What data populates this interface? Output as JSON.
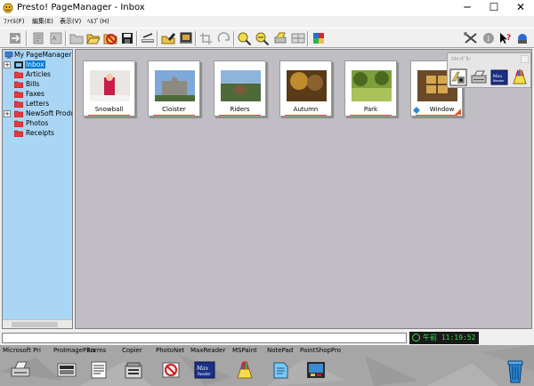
{
  "window": {
    "title": "Presto! PageManager - Inbox",
    "minimize_glyph": "─",
    "maximize_glyph": "☐",
    "close_glyph": "✕"
  },
  "menu": {
    "items": [
      {
        "label": "ﾌｧｲﾙ(F)"
      },
      {
        "label": "編集(E)"
      },
      {
        "label": "表示(V)"
      },
      {
        "label": "ﾍﾙﾌﾟ(H)"
      }
    ]
  },
  "toolbar": {
    "buttons": [
      {
        "icon": "send-icon"
      },
      {
        "icon": "page-icon"
      },
      {
        "icon": "ocr-icon"
      },
      {
        "icon": "folder-icon"
      },
      {
        "icon": "open-folder-icon"
      },
      {
        "icon": "no-entry-icon"
      },
      {
        "icon": "save-icon"
      },
      {
        "icon": "scan-icon"
      },
      {
        "icon": "edit-icon"
      },
      {
        "icon": "picture-icon"
      },
      {
        "icon": "crop-icon"
      },
      {
        "icon": "rotate-icon"
      },
      {
        "icon": "zoom-in-icon"
      },
      {
        "icon": "zoom-out-icon"
      },
      {
        "icon": "print-icon"
      },
      {
        "icon": "grid-icon"
      },
      {
        "icon": "stack-icon"
      },
      {
        "icon": "tools-icon"
      },
      {
        "icon": "info-icon"
      },
      {
        "icon": "help-icon"
      },
      {
        "icon": "scanner-icon"
      }
    ]
  },
  "tree": {
    "root": "My PageManager",
    "items": [
      {
        "label": "Inbox",
        "selected": true,
        "expander": "+"
      },
      {
        "label": "Articles"
      },
      {
        "label": "Bills"
      },
      {
        "label": "Faxes"
      },
      {
        "label": "Letters"
      },
      {
        "label": "NewSoft Products",
        "expander": "+"
      },
      {
        "label": "Photos"
      },
      {
        "label": "Receipts"
      }
    ]
  },
  "thumbnails": [
    {
      "name": "Snowball",
      "colors": [
        "#eae6e4",
        "#c61e48",
        "#f5f3f2"
      ]
    },
    {
      "name": "Cloister",
      "colors": [
        "#7fa9d8",
        "#8d8a80",
        "#4b6b3a"
      ]
    },
    {
      "name": "Riders",
      "colors": [
        "#8fb4dc",
        "#4d6b3a",
        "#7a5a3a"
      ]
    },
    {
      "name": "Autumn",
      "colors": [
        "#5a3b18",
        "#c08b2c",
        "#8b6130"
      ]
    },
    {
      "name": "Park",
      "colors": [
        "#7d9e3a",
        "#a9c25a",
        "#4a6a20"
      ]
    },
    {
      "name": "Window",
      "colors": [
        "#6a4a28",
        "#d8a650",
        "#3a2a18"
      ]
    }
  ],
  "scan_popup": {
    "caption": "ｽｷｬﾝﾎﾞﾀﾝ"
  },
  "status": {
    "text": "",
    "clock": "午前 11:19:52"
  },
  "launcher": {
    "items": [
      {
        "label": "Microsoft Pri",
        "icon": "printer-icon"
      },
      {
        "label": "ProImagePlus",
        "icon": "image-app-icon"
      },
      {
        "label": "Forms",
        "icon": "forms-icon"
      },
      {
        "label": "Copier",
        "icon": "copier-icon"
      },
      {
        "label": "PhotoNet",
        "icon": "photonet-icon"
      },
      {
        "label": "MaxReader",
        "icon": "maxreader-icon"
      },
      {
        "label": "MSPaint",
        "icon": "paint-icon"
      },
      {
        "label": "NotePad",
        "icon": "notepad-icon"
      },
      {
        "label": "PaintShopPro",
        "icon": "paintshop-icon"
      }
    ],
    "trash_icon": "trash-icon"
  },
  "colors": {
    "tree_bg": "#aad6f5",
    "content_bg": "#c0bec4",
    "folder": "#e23b3b",
    "selection": "#0078d7",
    "clock_text": "#39d94a"
  }
}
